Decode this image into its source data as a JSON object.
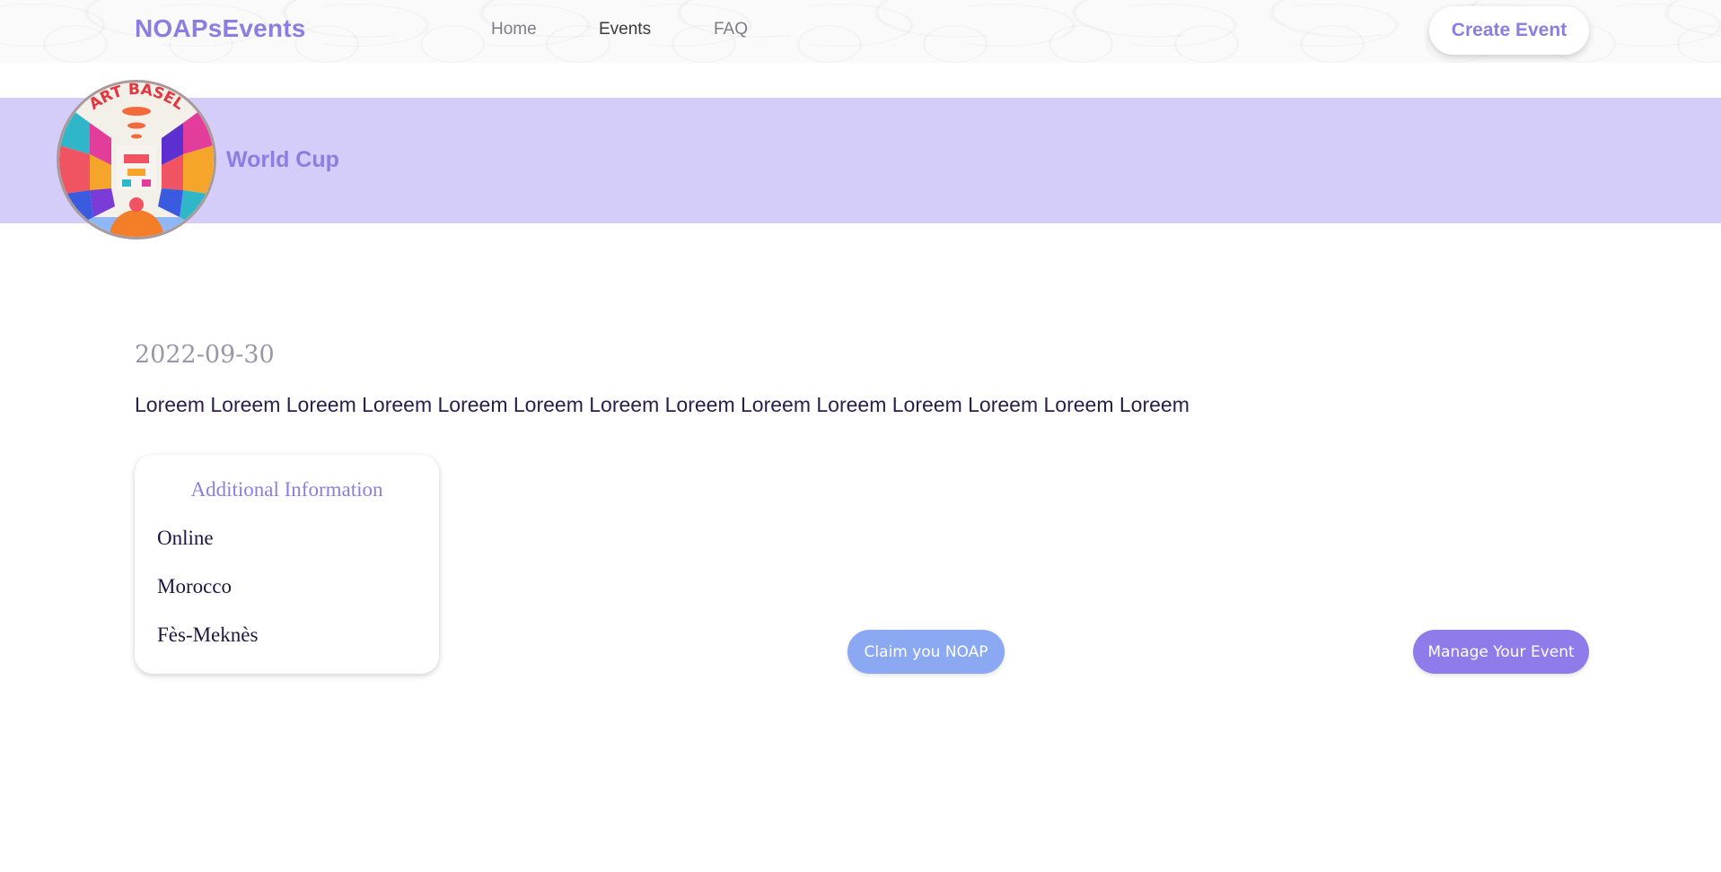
{
  "header": {
    "brand": "NOAPsEvents",
    "nav": [
      {
        "label": "Home",
        "active": false
      },
      {
        "label": "Events",
        "active": true
      },
      {
        "label": "FAQ",
        "active": false
      }
    ],
    "create_button": "Create Event"
  },
  "banner": {
    "avatar_text": "ART BASEL",
    "title": "World Cup"
  },
  "event": {
    "date": "2022-09-30",
    "description": "Loreem Loreem Loreem Loreem Loreem Loreem Loreem Loreem Loreem Loreem Loreem Loreem Loreem Loreem"
  },
  "info": {
    "title": "Additional Information",
    "items": [
      "Online",
      "Morocco",
      "Fès-Meknès"
    ]
  },
  "actions": {
    "claim": "Claim you NOAP",
    "manage": "Manage Your Event"
  },
  "colors": {
    "brand": "#8d7de3",
    "banner": "#d4cdfa",
    "claim_button": "#8ba9f3",
    "manage_button": "#8f7bea"
  }
}
